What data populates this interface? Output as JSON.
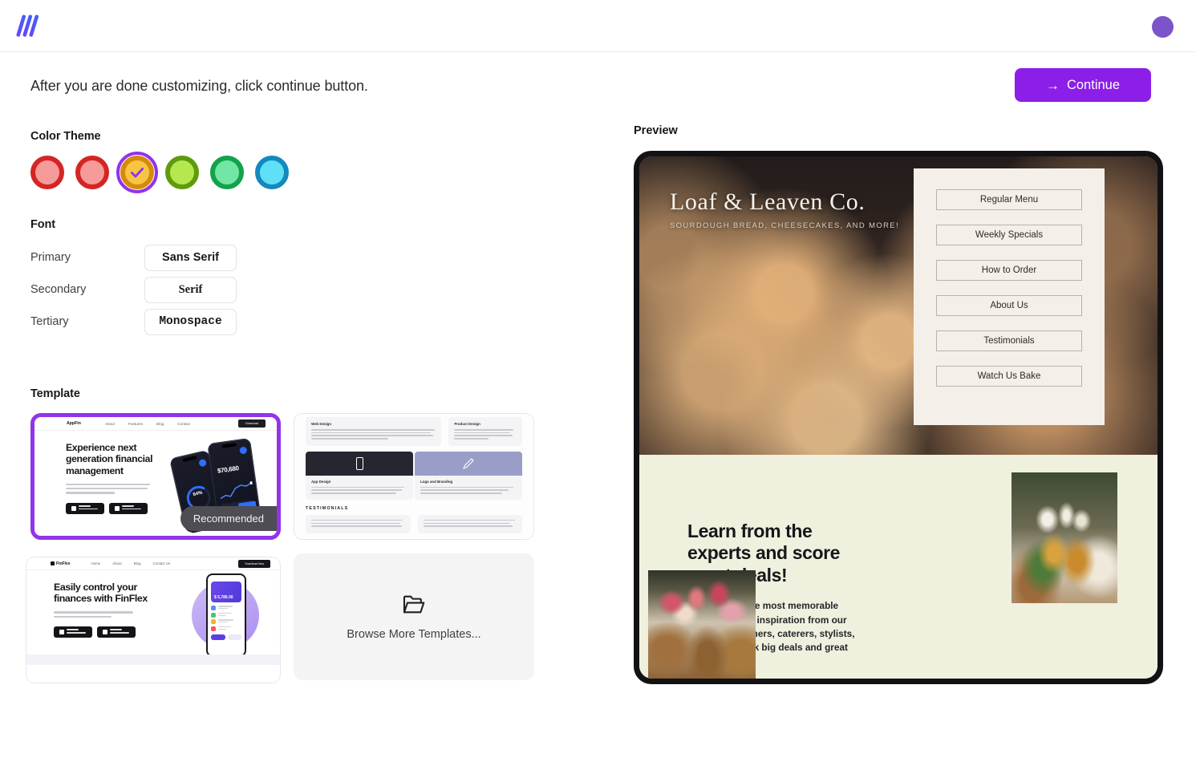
{
  "header": {
    "logo_icon": "triple-slash-logo",
    "avatar_icon": "user-avatar"
  },
  "instruction": {
    "text": "After you are done customizing, click continue button.",
    "continue_label": "Continue",
    "continue_arrow": "→",
    "continue_color": "#8b1fe8"
  },
  "color_theme": {
    "title": "Color Theme",
    "selected_index": 2,
    "check_icon": "check-icon",
    "swatches": [
      {
        "name": "red",
        "ring": "#d42525",
        "fill": "#f79a9a"
      },
      {
        "name": "red-2",
        "ring": "#d42525",
        "fill": "#f79a9a"
      },
      {
        "name": "amber",
        "ring": "#d68a0c",
        "fill": "#f7c544",
        "outline": "#9333ea"
      },
      {
        "name": "lime",
        "ring": "#5f9b0c",
        "fill": "#b5e84f"
      },
      {
        "name": "green",
        "ring": "#12a34a",
        "fill": "#73e6a6"
      },
      {
        "name": "cyan",
        "ring": "#1489bf",
        "fill": "#5fe0f7"
      }
    ]
  },
  "font": {
    "title": "Font",
    "rows": [
      {
        "label": "Primary",
        "value": "Sans Serif",
        "style": "ff-sans"
      },
      {
        "label": "Secondary",
        "value": "Serif",
        "style": "ff-serif"
      },
      {
        "label": "Tertiary",
        "value": "Monospace",
        "style": "ff-mono"
      }
    ]
  },
  "template": {
    "title": "Template",
    "selected_index": 0,
    "recommended_badge": "Recommended",
    "browse_more": {
      "label": "Browse More Templates...",
      "icon": "folder-open-icon"
    },
    "cards": [
      {
        "name": "appfin-template",
        "brand": "AppFin",
        "nav": [
          "About",
          "Features",
          "Blog",
          "Contact"
        ],
        "cta": "Download",
        "headline": "Experience next generation financial management",
        "phone_metric": "64%",
        "phone_amount": "$70,680",
        "recommended": true
      },
      {
        "name": "agency-template",
        "cards": [
          "Web Design",
          "Product Design",
          "App Design",
          "Logo and Branding"
        ],
        "section_title": "TESTIMONIALS"
      },
      {
        "name": "finflex-template",
        "brand": "FinFlex",
        "nav": [
          "Home",
          "About",
          "Blog",
          "Contact Us"
        ],
        "cta": "Download Now",
        "headline": "Easily control your finances with FinFlex",
        "phone_amount": "$ 5,786.00"
      }
    ]
  },
  "preview": {
    "title": "Preview",
    "hero": {
      "brand": "Loaf & Leaven Co.",
      "tagline": "SOURDOUGH BREAD, CHEESECAKES, AND MORE!",
      "image_alt": "bread-rolls-photo"
    },
    "menu_panel": {
      "items": [
        "Regular Menu",
        "Weekly Specials",
        "How to Order",
        "About Us",
        "Testimonials",
        "Watch Us Bake"
      ]
    },
    "lower": {
      "headline": "Learn from the experts and score great deals!",
      "body": "Put together the most memorable wedding. Draw inspiration from our featured designers, caterers, stylists, and more. Book big deals and great packages.",
      "image_tall_alt": "candles-table-photo",
      "image_wide_alt": "wedding-table-photo",
      "background": "#eff0de"
    }
  }
}
